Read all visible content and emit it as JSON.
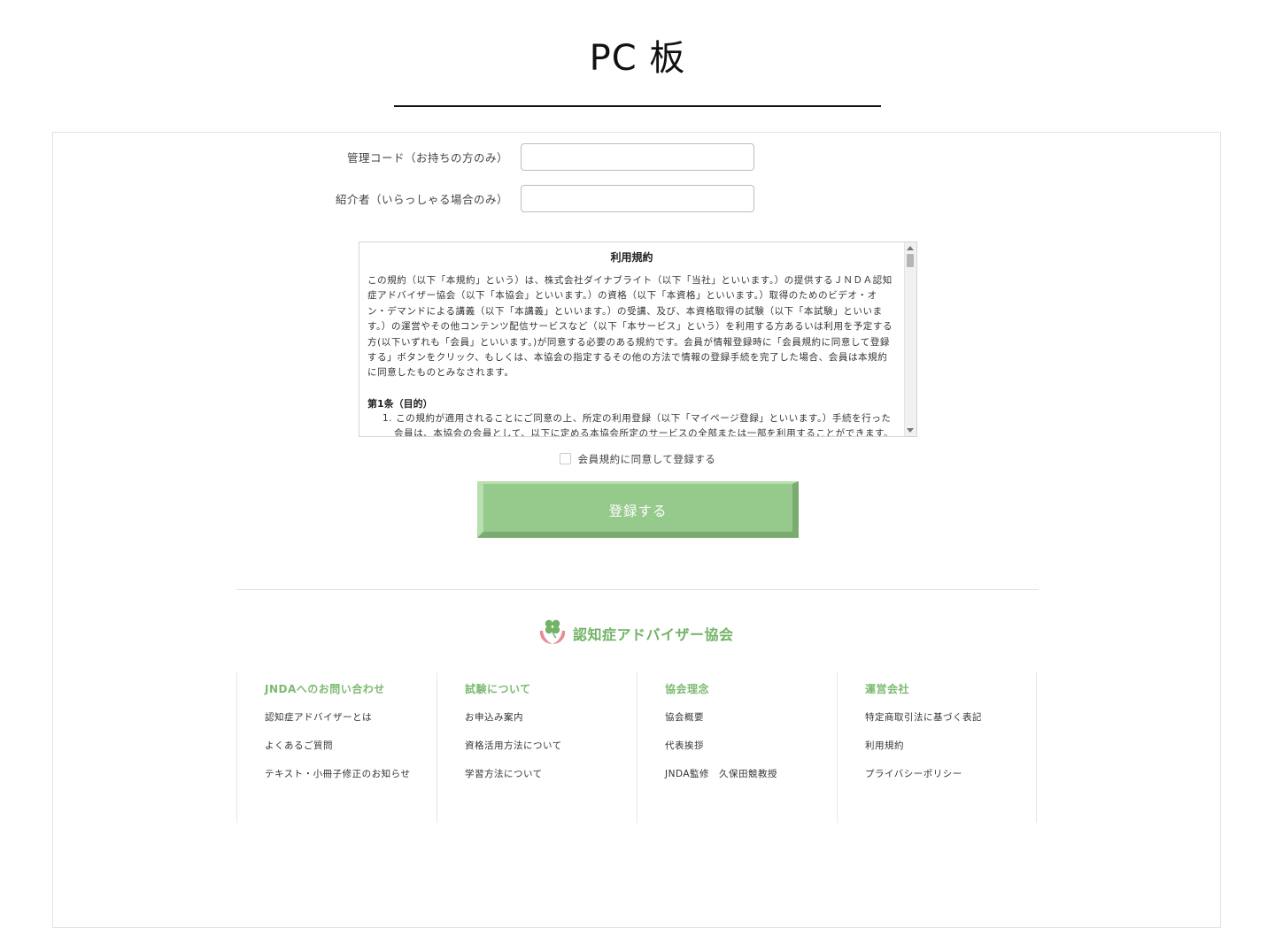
{
  "page_title": "PC 板",
  "form": {
    "rows": [
      {
        "label": "管理コード（お持ちの方のみ）",
        "value": ""
      },
      {
        "label": "紹介者（いらっしゃる場合のみ）",
        "value": ""
      }
    ]
  },
  "terms": {
    "title": "利用規約",
    "intro": "この規約（以下「本規約」という）は、株式会社ダイナブライト（以下「当社」といいます。）の提供するＪＮＤＡ認知症アドバイザー協会（以下「本協会」といいます。）の資格（以下「本資格」といいます。）取得のためのビデオ・オン・デマンドによる講義（以下「本講義」といいます。）の受講、及び、本資格取得の試験（以下「本試験」といいます。）の運営やその他コンテンツ配信サービスなど（以下「本サービス」という）を利用する方あるいは利用を予定する方(以下いずれも「会員」といいます。)が同意する必要のある規約です。会員が情報登録時に「会員規約に同意して登録する」ボタンをクリック、もしくは、本協会の指定するその他の方法で情報の登録手続を完了した場合、会員は本規約に同意したものとみなされます。",
    "article1_heading": "第1条（目的）",
    "article1_item1": "1. この規約が適用されることにご同意の上、所定の利用登録（以下「マイページ登録」といいます。）手続を行った会員は、本協会の会員として、以下に定める本協会所定のサービスの全部または一部を利用することができます。"
  },
  "agree_label": "会員規約に同意して登録する",
  "submit_label": "登録する",
  "footer": {
    "logo_text": "認知症アドバイザー協会",
    "columns": [
      {
        "heading": "JNDAへのお問い合わせ",
        "links": [
          "認知症アドバイザーとは",
          "よくあるご質問",
          "テキスト・小冊子修正のお知らせ"
        ]
      },
      {
        "heading": "試験について",
        "links": [
          "お申込み案内",
          "資格活用方法について",
          "学習方法について"
        ]
      },
      {
        "heading": "協会理念",
        "links": [
          "協会概要",
          "代表挨拶",
          "JNDA監修　久保田競教授"
        ]
      },
      {
        "heading": "運営会社",
        "links": [
          "特定商取引法に基づく表記",
          "利用規約",
          "プライバシーポリシー"
        ]
      }
    ]
  },
  "colors": {
    "accent_green": "#7dba71",
    "button_green": "#96c98c",
    "logo_pink": "#e88a96"
  }
}
